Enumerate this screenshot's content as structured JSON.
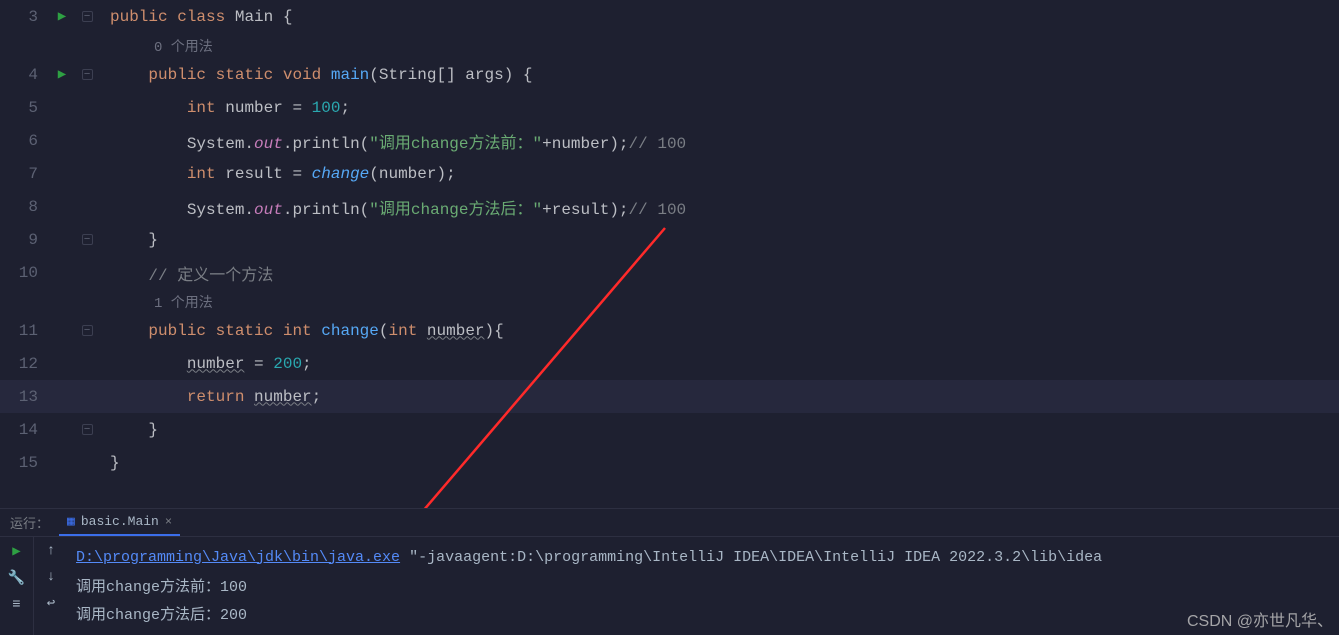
{
  "run_label": "运行：",
  "tab": {
    "title": "basic.Main",
    "close": "×"
  },
  "gutter_icons": {
    "run": "▶",
    "minus": "−",
    "plus": "+"
  },
  "inlays": {
    "usages0": "0 个用法",
    "usages1": "1 个用法"
  },
  "lines": {
    "3": "3",
    "4": "4",
    "5": "5",
    "6": "6",
    "7": "7",
    "8": "8",
    "9": "9",
    "10": "10",
    "11": "11",
    "12": "12",
    "13": "13",
    "14": "14",
    "15": "15"
  },
  "code": {
    "l3_kw1": "public",
    "l3_kw2": "class",
    "l3_cls": "Main",
    "l3_b": "{",
    "l4_kw1": "public",
    "l4_kw2": "static",
    "l4_kw3": "void",
    "l4_fn": "main",
    "l4_p": "(String[] args) {",
    "l5_kw": "int",
    "l5_id": "number",
    "l5_eq": " = ",
    "l5_num": "100",
    "l5_end": ";",
    "l6_sys": "System",
    "l6_dot1": ".",
    "l6_out": "out",
    "l6_dot2": ".",
    "l6_p": "println",
    "l6_lp": "(",
    "l6_str": "\"调用change方法前：\"",
    "l6_plus": "+",
    "l6_id": "number",
    "l6_rp": ");",
    "l6_cmt": "// 100",
    "l7_kw": "int",
    "l7_id": "result",
    "l7_eq": " = ",
    "l7_fn": "change",
    "l7_lp": "(",
    "l7_arg": "number",
    "l7_rp": ");",
    "l8_sys": "System",
    "l8_dot1": ".",
    "l8_out": "out",
    "l8_dot2": ".",
    "l8_p": "println",
    "l8_lp": "(",
    "l8_str": "\"调用change方法后：\"",
    "l8_plus": "+",
    "l8_id": "result",
    "l8_rp": ");",
    "l8_cmt": "// 100",
    "l9": "}",
    "l10_cmt": "// 定义一个方法",
    "l11_kw1": "public",
    "l11_kw2": "static",
    "l11_kw3": "int",
    "l11_fn": "change",
    "l11_lp": "(",
    "l11_pt": "int",
    "l11_pn": "number",
    "l11_rp": "){",
    "l12_id": "number",
    "l12_eq": " = ",
    "l12_num": "200",
    "l12_end": ";",
    "l13_kw": "return",
    "l13_id": "number",
    "l13_end": ";",
    "l14": "}",
    "l15": "}"
  },
  "console": {
    "exe": "D:\\programming\\Java\\jdk\\bin\\java.exe",
    "rest": " \"-javaagent:D:\\programming\\IntelliJ IDEA\\IDEA\\IntelliJ IDEA 2022.3.2\\lib\\idea",
    "out1": "调用change方法前：100",
    "out2": "调用change方法后：200"
  },
  "tool_icons": {
    "run": "▶",
    "up": "↑",
    "wrench": "🔧",
    "down": "↓",
    "dbg": "≡",
    "wrap": "↩"
  },
  "watermark": "CSDN @亦世凡华、"
}
